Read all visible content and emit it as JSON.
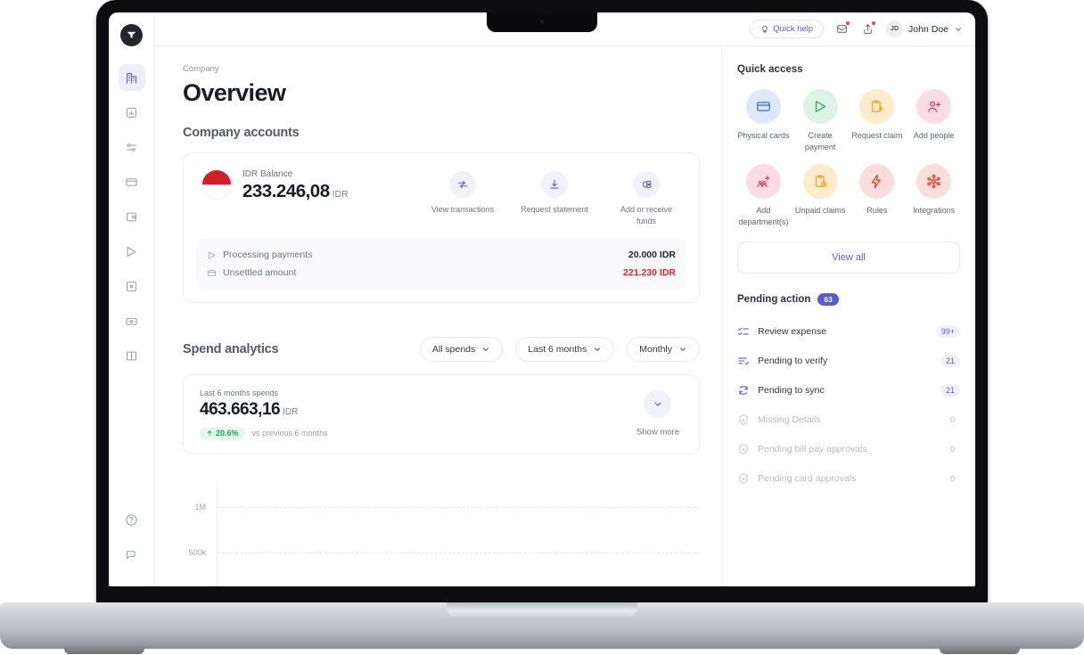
{
  "sidebar": {
    "logo_name": "app-logo",
    "items": [
      {
        "label": "Company overview",
        "icon": "company-building-icon",
        "active": true
      },
      {
        "label": "Analytics",
        "icon": "chart-square-icon",
        "active": false
      },
      {
        "label": "Transactions",
        "icon": "transactions-settings-icon",
        "active": false
      },
      {
        "label": "Cards",
        "icon": "card-icon",
        "active": false
      },
      {
        "label": "Expenses",
        "icon": "wallet-plus-icon",
        "active": false
      },
      {
        "label": "Payments",
        "icon": "send-icon",
        "active": false
      },
      {
        "label": "Bills",
        "icon": "bill-icon",
        "active": false
      },
      {
        "label": "Reimbursements",
        "icon": "money-card-icon",
        "active": false
      },
      {
        "label": "Reports",
        "icon": "book-icon",
        "active": false
      }
    ],
    "bottom_items": [
      {
        "label": "Help",
        "icon": "help-circle-icon"
      },
      {
        "label": "Support chat",
        "icon": "chat-icon"
      }
    ]
  },
  "topbar": {
    "quick_help": "Quick help",
    "quick_help_icon": "lightbulb-icon",
    "inbox_icon": "inbox-icon",
    "share_icon": "share-upload-icon",
    "avatar_initials": "JD",
    "user_name": "John Doe",
    "caret_icon": "chevron-down-icon"
  },
  "page": {
    "breadcrumb": "Company",
    "title": "Overview",
    "accounts_title": "Company accounts"
  },
  "balance": {
    "flag_icon": "indonesia-flag-icon",
    "label": "IDR Balance",
    "amount": "233.246,08",
    "currency": "IDR",
    "actions": [
      {
        "label": "View transactions",
        "icon": "transfer-arrows-icon"
      },
      {
        "label": "Request statement",
        "icon": "download-icon"
      },
      {
        "label": "Add or receive funds",
        "icon": "add-funds-icon"
      }
    ],
    "rows": [
      {
        "label": "Processing payments",
        "value": "20.000 IDR",
        "icon": "send-icon",
        "red": false
      },
      {
        "label": "Unsettled amount",
        "value": "221.230 IDR",
        "icon": "card-icon",
        "red": true
      }
    ]
  },
  "spend": {
    "title": "Spend analytics",
    "filters": [
      {
        "label": "All spends"
      },
      {
        "label": "Last 6 months"
      },
      {
        "label": "Monthly"
      }
    ],
    "sub_label": "Last 6 months spends",
    "amount": "463.663,16",
    "currency": "IDR",
    "delta": "20.6%",
    "delta_icon": "arrow-up-icon",
    "delta_note": "vs previous 6 months",
    "show_more": "Show more",
    "show_more_icon": "chevron-down-icon"
  },
  "chart_data": {
    "type": "bar",
    "title": "Spend analytics",
    "categories": [],
    "values": [],
    "xlabel": "",
    "ylabel": "",
    "yticks": [
      "1M",
      "500k"
    ],
    "ylim": [
      0,
      1200000
    ],
    "grid": true,
    "legend": "none"
  },
  "quick_access": {
    "title": "Quick access",
    "items": [
      {
        "label": "Physical cards",
        "icon": "credit-card-icon",
        "bg": "#dce8fb",
        "fg": "#4071d8"
      },
      {
        "label": "Create payment",
        "icon": "send-plane-icon",
        "bg": "#ddf3e6",
        "fg": "#2faa6d"
      },
      {
        "label": "Request claim",
        "icon": "clipboard-plus-icon",
        "bg": "#fdeccb",
        "fg": "#eaa82c"
      },
      {
        "label": "Add people",
        "icon": "user-plus-icon",
        "bg": "#fbdce5",
        "fg": "#e0416e"
      },
      {
        "label": "Add department(s)",
        "icon": "org-add-icon",
        "bg": "#fbdce5",
        "fg": "#e0416e"
      },
      {
        "label": "Unpaid claims",
        "icon": "clipboard-clock-icon",
        "bg": "#fdeccb",
        "fg": "#eaa82c"
      },
      {
        "label": "Rules",
        "icon": "lightning-icon",
        "bg": "#fadede",
        "fg": "#e4472c"
      },
      {
        "label": "Integrations",
        "icon": "integrations-node-icon",
        "bg": "#fadede",
        "fg": "#e4472c"
      }
    ],
    "view_all": "View all"
  },
  "pending": {
    "title": "Pending action",
    "count": "63",
    "rows": [
      {
        "label": "Review expense",
        "count": "99+",
        "icon": "checklist-icon",
        "dim": false
      },
      {
        "label": "Pending to verify",
        "count": "21",
        "icon": "list-check-icon",
        "dim": false
      },
      {
        "label": "Pending to sync",
        "count": "21",
        "icon": "sync-icon",
        "dim": false
      },
      {
        "label": "Missing Details",
        "count": "0",
        "icon": "shield-icon",
        "dim": true
      },
      {
        "label": "Pending bill pay approvals",
        "count": "0",
        "icon": "shield-icon",
        "dim": true
      },
      {
        "label": "Pending card approvals",
        "count": "0",
        "icon": "shield-icon",
        "dim": true
      }
    ]
  },
  "colors": {
    "accent": "#5b5bd6",
    "danger": "#e0262b",
    "success": "#17a35c"
  }
}
